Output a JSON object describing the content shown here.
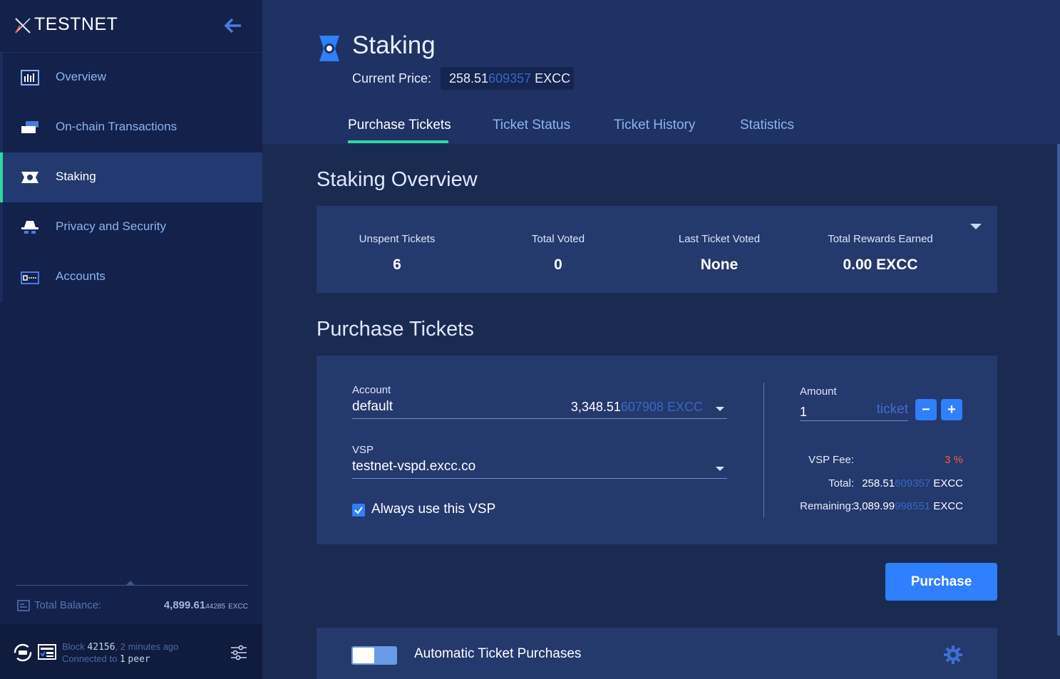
{
  "app": {
    "brand": "TESTNET"
  },
  "sidebar": {
    "items": [
      {
        "label": "Overview",
        "icon": "overview-icon",
        "active": false
      },
      {
        "label": "On-chain Transactions",
        "icon": "transactions-icon",
        "active": false
      },
      {
        "label": "Staking",
        "icon": "staking-icon",
        "active": true
      },
      {
        "label": "Privacy and Security",
        "icon": "privacy-icon",
        "active": false
      },
      {
        "label": "Accounts",
        "icon": "accounts-icon",
        "active": false
      }
    ],
    "balance": {
      "label": "Total Balance:",
      "main": "4,899.61",
      "fraction": "44285",
      "unit": "EXCC"
    },
    "status": {
      "block_label": "Block",
      "block_number": "42156",
      "block_time": ", 2 minutes ago",
      "connected_label": "Connected to",
      "peer_count": "1",
      "peer_word": "peer"
    }
  },
  "header": {
    "title": "Staking",
    "price_label": "Current Price:",
    "price_main": "258.51",
    "price_fraction": "609357",
    "price_unit": "EXCC",
    "tabs": [
      {
        "label": "Purchase Tickets",
        "active": true
      },
      {
        "label": "Ticket Status",
        "active": false
      },
      {
        "label": "Ticket History",
        "active": false
      },
      {
        "label": "Statistics",
        "active": false
      }
    ]
  },
  "overview": {
    "title": "Staking Overview",
    "stats": [
      {
        "label": "Unspent Tickets",
        "value": "6"
      },
      {
        "label": "Total Voted",
        "value": "0"
      },
      {
        "label": "Last Ticket Voted",
        "value": "None"
      },
      {
        "label": "Total Rewards Earned",
        "value": "0.00 EXCC"
      }
    ]
  },
  "purchase": {
    "title": "Purchase Tickets",
    "account_label": "Account",
    "account_value": "default",
    "account_balance_main": "3,348.51",
    "account_balance_fraction": "607908",
    "account_balance_unit": "EXCC",
    "vsp_label": "VSP",
    "vsp_value": "testnet-vspd.excc.co",
    "always_vsp_label": "Always use this VSP",
    "always_vsp_checked": true,
    "amount_label": "Amount",
    "amount_value": "1",
    "amount_unit": "ticket",
    "decrement_label": "−",
    "increment_label": "+",
    "vsp_fee_label": "VSP Fee:",
    "vsp_fee_value": "3 %",
    "total_label": "Total:",
    "total_main": "258.51",
    "total_fraction": "609357",
    "total_unit": "EXCC",
    "remaining_label": "Remaining:",
    "remaining_main": "3,089.99",
    "remaining_fraction": "998551",
    "remaining_unit": "EXCC",
    "button_label": "Purchase"
  },
  "auto": {
    "label": "Automatic Ticket Purchases",
    "enabled": false
  },
  "colors": {
    "accent": "#2ed8a3",
    "primary_button": "#2f7fff",
    "fee": "#ff5b45"
  }
}
